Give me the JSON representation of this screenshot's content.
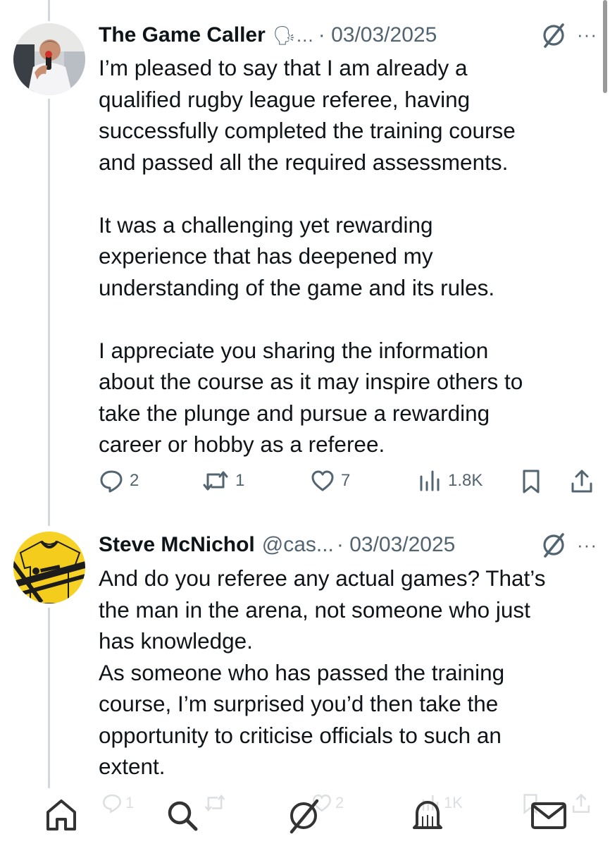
{
  "tweets": [
    {
      "name": "The Game Caller",
      "name_emoji": "🗣…",
      "handle": "",
      "date": "· 03/03/2025",
      "more": "···",
      "text": "I’m pleased to say that I am already a\nqualified rugby league referee, having\nsuccessfully completed the training course\nand passed all the required assessments.\n\nIt was a challenging yet rewarding\nexperience that has deepened my\nunderstanding of the game and its rules.\n\nI appreciate you sharing the information\nabout the course as it may inspire others to\ntake the plunge and pursue a rewarding\ncareer or hobby as a referee.",
      "replies": "2",
      "reposts": "1",
      "likes": "7",
      "views": "1.8K"
    },
    {
      "name": "Steve McNichol",
      "handle": "@cas...",
      "date": "· 03/03/2025",
      "more": "···",
      "text": "And do you referee any actual games? That’s\nthe man in the arena, not someone who just\nhas knowledge.\nAs someone who has passed the training\ncourse, I’m surprised you’d then take the\nopportunity to criticise officials to such an\nextent.",
      "replies": "1",
      "reposts": "",
      "likes": "2",
      "views": "1K"
    }
  ],
  "icons": {
    "avatar1": "person-with-microphone-avatar",
    "avatar2": "yellow-rugby-shirt-avatar",
    "grok": "grok-icon",
    "reply": "reply-icon",
    "repost": "repost-icon",
    "like": "like-icon",
    "views": "views-icon",
    "bookmark": "bookmark-icon",
    "share": "share-icon"
  },
  "bottom_nav": [
    "home-icon",
    "search-icon",
    "grok-icon",
    "notifications-icon",
    "messages-icon"
  ],
  "colors": {
    "text": "#0f1419",
    "muted": "#536471",
    "thread": "#cfd9de"
  }
}
